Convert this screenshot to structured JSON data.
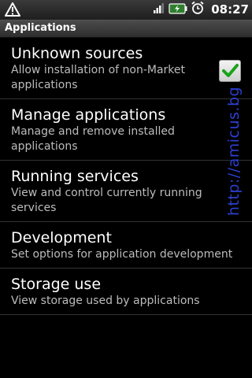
{
  "statusbar": {
    "time": "08:27",
    "icons": [
      "warning-icon",
      "signal-icon",
      "battery-icon",
      "alarm-icon"
    ]
  },
  "title": "Applications",
  "items": [
    {
      "title": "Unknown sources",
      "subtitle": "Allow installation of non-Market applications",
      "checked": true
    },
    {
      "title": "Manage applications",
      "subtitle": "Manage and remove installed applications"
    },
    {
      "title": "Running services",
      "subtitle": "View and control currently running services"
    },
    {
      "title": "Development",
      "subtitle": "Set options for application development"
    },
    {
      "title": "Storage use",
      "subtitle": "View storage used by applications"
    }
  ],
  "watermark": "http://amicus.bg",
  "colors": {
    "watermark": "#2d3fd0",
    "check": "#19a319"
  }
}
